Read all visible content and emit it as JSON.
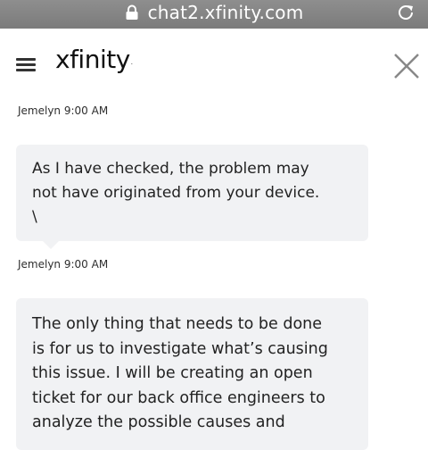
{
  "browser": {
    "url": "chat2.xfinity.com",
    "icons": {
      "lock": "lock-icon",
      "reload": "reload-icon"
    }
  },
  "header": {
    "logo_text": "xfinity",
    "icons": {
      "menu": "hamburger-menu-icon",
      "close": "close-icon"
    }
  },
  "messages": [
    {
      "sender_line": "Jemelyn 9:00 AM",
      "lines": [
        "As I have checked, the problem may",
        "not have originated from your device.",
        "\\"
      ]
    },
    {
      "sender_line": "Jemelyn 9:00 AM",
      "lines": [
        "The only thing that needs to be done",
        "is for us to investigate what’s causing",
        "this issue. I will be creating an open",
        "ticket for our back office engineers to",
        "analyze the possible causes and"
      ]
    }
  ]
}
